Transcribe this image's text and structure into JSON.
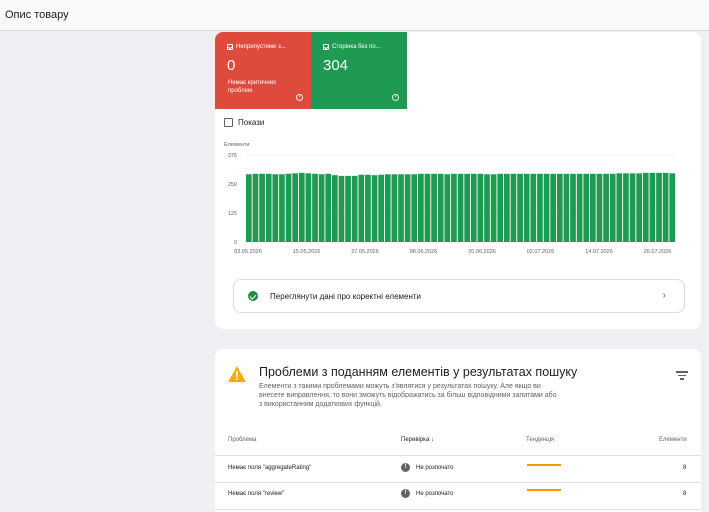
{
  "page_title": "Опис товару",
  "summary": {
    "invalid": {
      "label": "Неприпустиме з...",
      "count": "0",
      "sub": "Немає критичних проблем",
      "color": "#de4a3c"
    },
    "valid": {
      "label": "Сторінка без по...",
      "count": "304",
      "color": "#1e9a52"
    }
  },
  "show_label": "Покази",
  "chart_data": {
    "type": "bar",
    "ylabel": "Елементи",
    "ylim": [
      0,
      375
    ],
    "yticks": [
      "375",
      "250",
      "125",
      "0"
    ],
    "xtick_labels": [
      "03.05.2026",
      "15.05.2026",
      "27.05.2026",
      "08.06.2026",
      "20.06.2026",
      "02.07.2026",
      "14.07.2026",
      "26.07.2026"
    ],
    "values": [
      292,
      294,
      294,
      294,
      292,
      292,
      294,
      296,
      298,
      296,
      294,
      292,
      294,
      288,
      285,
      285,
      285,
      290,
      290,
      288,
      290,
      292,
      292,
      292,
      292,
      292,
      294,
      294,
      294,
      294,
      292,
      294,
      294,
      294,
      294,
      294,
      292,
      292,
      294,
      294,
      294,
      294,
      294,
      294,
      294,
      294,
      294,
      294,
      294,
      294,
      294,
      294,
      294,
      294,
      294,
      294,
      296,
      296,
      296,
      296,
      298,
      298,
      298,
      298,
      296
    ],
    "bar_color": "#1e9a52"
  },
  "valid_link": "Переглянути дані про коректні елементи",
  "issues": {
    "title": "Проблеми з поданням елементів у результатах пошуку",
    "desc": "Елементи з такими проблемами можуть з'являтися у результатах пошуку. Але якщо ви внесете виправлення, то вони зможуть відображатись за більш відповідними запитами або з використанням додаткових функцій.",
    "headers": {
      "issue": "Проблема",
      "check": "Перевірка",
      "trend": "Тенденція",
      "items": "Елементи"
    },
    "rows": [
      {
        "name": "Немає поля \"aggregateRating\"",
        "status": "Не розпочато",
        "count": "8"
      },
      {
        "name": "Немає поля \"review\"",
        "status": "Не розпочато",
        "count": "8"
      }
    ]
  }
}
